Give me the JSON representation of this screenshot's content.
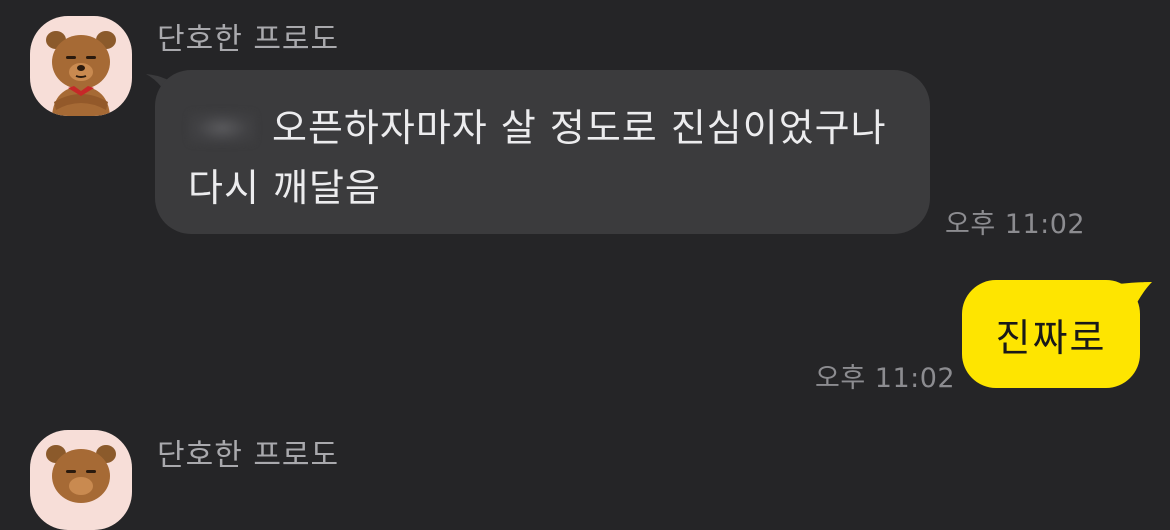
{
  "messages": [
    {
      "sender": "단호한 프로도",
      "text": "오픈하자마자 살 정도로 진심이었구나 다시 깨달음",
      "time": "오후 11:02",
      "direction": "incoming"
    },
    {
      "text": "진짜로",
      "time": "오후 11:02",
      "direction": "outgoing"
    },
    {
      "sender": "단호한 프로도",
      "direction": "incoming"
    }
  ],
  "colors": {
    "background": "#252527",
    "incoming_bubble": "#3b3b3d",
    "outgoing_bubble": "#fee500",
    "name_text": "#a9a9ad",
    "time_text": "#8c8c90"
  },
  "icons": {
    "avatar": "bear-character-avatar-icon"
  }
}
